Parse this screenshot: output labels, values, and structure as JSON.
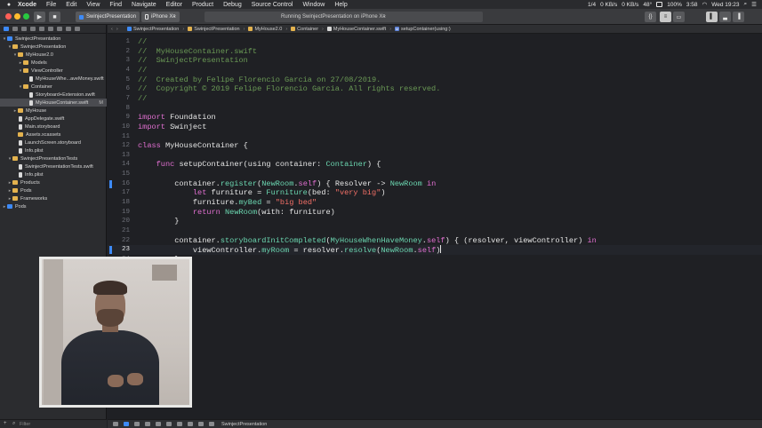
{
  "menubar": {
    "items": [
      "Xcode",
      "File",
      "Edit",
      "View",
      "Find",
      "Navigate",
      "Editor",
      "Product",
      "Debug",
      "Source Control",
      "Window",
      "Help"
    ],
    "status": {
      "pages": "1/4",
      "network_up": "0 KB/s",
      "network_down": "0 KB/s",
      "temperature": "48°",
      "battery": "100%",
      "time_small": "3:58",
      "clock": "Wed 19:23"
    }
  },
  "toolbar": {
    "scheme": "SwinjectPresentation",
    "device": "iPhone Xʀ",
    "activity": "Running SwinjectPresentation on iPhone Xʀ"
  },
  "navigator": {
    "items": [
      {
        "label": "SwinjectPresentation",
        "kind": "proj",
        "indent": 0,
        "disclosure": "▾"
      },
      {
        "label": "SwinjectPresentation",
        "kind": "folder",
        "indent": 1,
        "disclosure": "▾"
      },
      {
        "label": "MyHouse2.0",
        "kind": "folder",
        "indent": 2,
        "disclosure": "▾"
      },
      {
        "label": "Models",
        "kind": "folder",
        "indent": 3,
        "disclosure": "▸"
      },
      {
        "label": "ViewController",
        "kind": "folder",
        "indent": 3,
        "disclosure": "▾"
      },
      {
        "label": "MyHouseWhe...aveMoney.swift",
        "kind": "file",
        "indent": 4,
        "disclosure": ""
      },
      {
        "label": "Container",
        "kind": "folder",
        "indent": 3,
        "disclosure": "▾"
      },
      {
        "label": "Storyboard+Extension.swift",
        "kind": "file",
        "indent": 4,
        "disclosure": ""
      },
      {
        "label": "MyHouseContainer.swift",
        "kind": "file",
        "indent": 4,
        "disclosure": "",
        "selected": true,
        "badge": "M"
      },
      {
        "label": "MyHouse",
        "kind": "folder",
        "indent": 2,
        "disclosure": "▸"
      },
      {
        "label": "AppDelegate.swift",
        "kind": "file",
        "indent": 2,
        "disclosure": ""
      },
      {
        "label": "Main.storyboard",
        "kind": "file",
        "indent": 2,
        "disclosure": ""
      },
      {
        "label": "Assets.xcassets",
        "kind": "folder",
        "indent": 2,
        "disclosure": ""
      },
      {
        "label": "LaunchScreen.storyboard",
        "kind": "file",
        "indent": 2,
        "disclosure": ""
      },
      {
        "label": "Info.plist",
        "kind": "file",
        "indent": 2,
        "disclosure": ""
      },
      {
        "label": "SwinjectPresentationTests",
        "kind": "folder",
        "indent": 1,
        "disclosure": "▾"
      },
      {
        "label": "SwinjectPresentationTests.swift",
        "kind": "file",
        "indent": 2,
        "disclosure": ""
      },
      {
        "label": "Info.plist",
        "kind": "file",
        "indent": 2,
        "disclosure": ""
      },
      {
        "label": "Products",
        "kind": "folder",
        "indent": 1,
        "disclosure": "▸"
      },
      {
        "label": "Pods",
        "kind": "folder",
        "indent": 1,
        "disclosure": "▸"
      },
      {
        "label": "Frameworks",
        "kind": "folder",
        "indent": 1,
        "disclosure": "▸"
      },
      {
        "label": "Pods",
        "kind": "proj",
        "indent": 0,
        "disclosure": "▸"
      }
    ]
  },
  "jumpbar": {
    "crumbs": [
      {
        "label": "SwinjectPresentation",
        "icon": "proj"
      },
      {
        "label": "SwinjectPresentation",
        "icon": "folder"
      },
      {
        "label": "MyHouse2.0",
        "icon": "folder"
      },
      {
        "label": "Container",
        "icon": "folder"
      },
      {
        "label": "MyHouseContainer.swift",
        "icon": "file"
      },
      {
        "label": "setupContainer(using:)",
        "icon": "m"
      }
    ]
  },
  "editor": {
    "current_line": 23,
    "lines": [
      [
        [
          "c",
          "//"
        ]
      ],
      [
        [
          "c",
          "//  MyHouseContainer.swift"
        ]
      ],
      [
        [
          "c",
          "//  SwinjectPresentation"
        ]
      ],
      [
        [
          "c",
          "//"
        ]
      ],
      [
        [
          "c",
          "//  Created by Felipe Florencio Garcia on 27/08/2019."
        ]
      ],
      [
        [
          "c",
          "//  Copyright © 2019 Felipe Florencio Garcia. All rights reserved."
        ]
      ],
      [
        [
          "c",
          "//"
        ]
      ],
      [],
      [
        [
          "k",
          "import"
        ],
        [
          "p",
          " Foundation"
        ]
      ],
      [
        [
          "k",
          "import"
        ],
        [
          "p",
          " Swinject"
        ]
      ],
      [],
      [
        [
          "k",
          "class"
        ],
        [
          "p",
          " MyHouseContainer {"
        ]
      ],
      [],
      [
        [
          "p",
          "    "
        ],
        [
          "k",
          "func"
        ],
        [
          "p",
          " setupContainer(using container: "
        ],
        [
          "t",
          "Container"
        ],
        [
          "p",
          ") {"
        ]
      ],
      [],
      [
        [
          "p",
          "        container."
        ],
        [
          "t",
          "register"
        ],
        [
          "p",
          "("
        ],
        [
          "t",
          "NewRoom"
        ],
        [
          "p",
          "."
        ],
        [
          "k",
          "self"
        ],
        [
          "p",
          ") { Resolver -> "
        ],
        [
          "t",
          "NewRoom"
        ],
        [
          "p",
          " "
        ],
        [
          "k",
          "in"
        ]
      ],
      [
        [
          "p",
          "            "
        ],
        [
          "k",
          "let"
        ],
        [
          "p",
          " furniture = "
        ],
        [
          "t",
          "Furniture"
        ],
        [
          "p",
          "(bed: "
        ],
        [
          "s",
          "\"very big\""
        ],
        [
          "p",
          ")"
        ]
      ],
      [
        [
          "p",
          "            furniture."
        ],
        [
          "t",
          "myBed"
        ],
        [
          "p",
          " = "
        ],
        [
          "s",
          "\"big bed\""
        ]
      ],
      [
        [
          "p",
          "            "
        ],
        [
          "k",
          "return"
        ],
        [
          "p",
          " "
        ],
        [
          "t",
          "NewRoom"
        ],
        [
          "p",
          "(with: furniture)"
        ]
      ],
      [
        [
          "p",
          "        }"
        ]
      ],
      [],
      [
        [
          "p",
          "        container."
        ],
        [
          "t",
          "storyboardInitCompleted"
        ],
        [
          "p",
          "("
        ],
        [
          "t",
          "MyHouseWhenHaveMoney"
        ],
        [
          "p",
          "."
        ],
        [
          "k",
          "self"
        ],
        [
          "p",
          ") { (resolver, viewController) "
        ],
        [
          "k",
          "in"
        ]
      ],
      [
        [
          "p",
          "            viewController."
        ],
        [
          "t",
          "myRoom"
        ],
        [
          "p",
          " = resolver."
        ],
        [
          "t",
          "resolve"
        ],
        [
          "p",
          "("
        ],
        [
          "t",
          "NewRoom"
        ],
        [
          "p",
          "."
        ],
        [
          "k",
          "self"
        ],
        [
          "p",
          ")"
        ]
      ],
      [
        [
          "p",
          "        }"
        ]
      ]
    ]
  },
  "navigator_filter": {
    "placeholder": "Filter"
  },
  "debugbar": {
    "scheme": "SwinjectPresentation"
  },
  "colors": {
    "background": "#1f2024",
    "comment": "#6a9955",
    "keyword": "#e06fd0",
    "type": "#6bd6b0",
    "string": "#f47067",
    "selection_accent": "#3d8af7"
  }
}
